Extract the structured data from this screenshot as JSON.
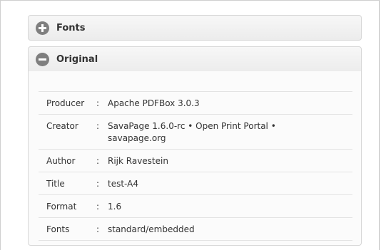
{
  "sections": {
    "fonts": {
      "title": "Fonts",
      "icon": "plus-circle-icon"
    },
    "original": {
      "title": "Original",
      "icon": "minus-circle-icon"
    }
  },
  "original_table": {
    "separator": ":",
    "rows": [
      {
        "key": "Producer",
        "value": "Apache PDFBox 3.0.3"
      },
      {
        "key": "Creator",
        "value": "SavaPage 1.6.0-rc • Open Print Portal • savapage.org"
      },
      {
        "key": "Author",
        "value": "Rijk Ravestein"
      },
      {
        "key": "Title",
        "value": "test-A4"
      },
      {
        "key": "Format",
        "value": "1.6"
      },
      {
        "key": "Fonts",
        "value": "standard/embedded"
      }
    ]
  }
}
